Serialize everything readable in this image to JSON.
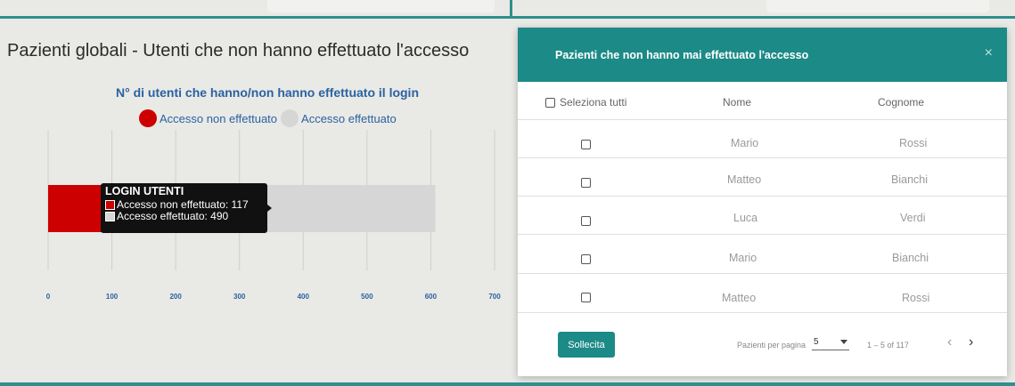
{
  "page": {
    "title": "Pazienti globali - Utenti che non hanno effettuato l'accesso"
  },
  "colors": {
    "teal": "#1c8a87",
    "not_accessed": "#cc0000",
    "accessed": "#d6d6d6",
    "axis_text": "#2a62a0"
  },
  "chart_data": {
    "type": "bar",
    "orientation": "horizontal",
    "stacked": true,
    "title": "N° di utenti che hanno/non hanno effettuato il login",
    "categories": [
      "LOGIN UTENTI"
    ],
    "series": [
      {
        "name": "Accesso non effettuato",
        "values": [
          117
        ],
        "color": "#cc0000"
      },
      {
        "name": "Accesso effettuato",
        "values": [
          490
        ],
        "color": "#d6d6d6"
      }
    ],
    "xlim": [
      0,
      700
    ],
    "xticks": [
      "0",
      "100",
      "200",
      "300",
      "400",
      "500",
      "600",
      "700"
    ],
    "grid": true,
    "legend_position": "top"
  },
  "tooltip": {
    "title": "LOGIN UTENTI",
    "line1": "Accesso non effettuato: 117",
    "line2": "Accesso effettuato: 490"
  },
  "panel": {
    "title": "Pazienti che non hanno mai effettuato l'accesso",
    "close_icon": "×",
    "header": {
      "select_all": "Seleziona tutti",
      "col_name": "Nome",
      "col_surname": "Cognome"
    },
    "rows": [
      {
        "nome": "Mario",
        "cognome": "Rossi"
      },
      {
        "nome": "Matteo",
        "cognome": "Bianchi"
      },
      {
        "nome": "Luca",
        "cognome": "Verdi"
      },
      {
        "nome": "Mario",
        "cognome": "Bianchi"
      },
      {
        "nome": "Matteo",
        "cognome": "Rossi"
      }
    ],
    "button_label": "Sollecita",
    "pagination": {
      "per_page_label": "Pazienti per pagina",
      "per_page_value": "5",
      "range": "1 – 5 of 117",
      "prev_icon": "‹",
      "next_icon": "›"
    }
  }
}
